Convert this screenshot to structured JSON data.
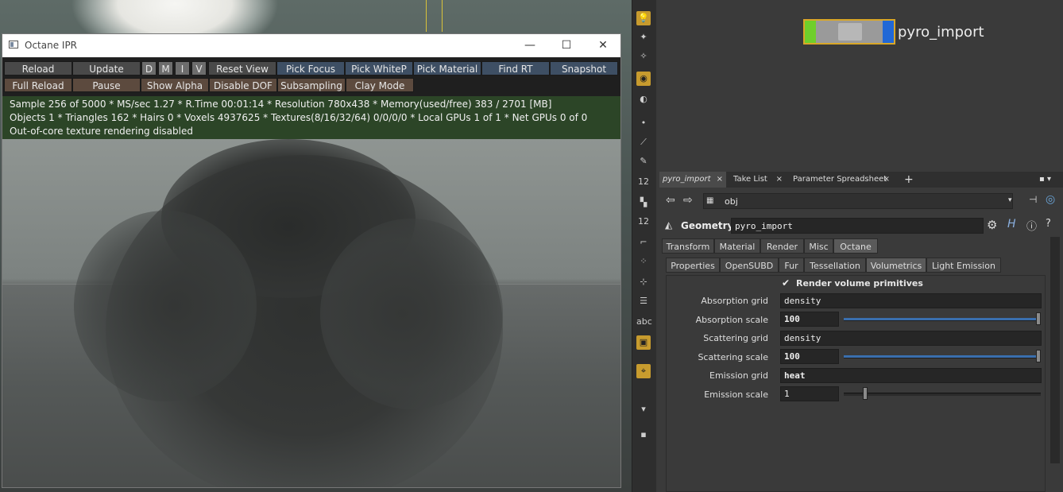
{
  "octane_window": {
    "title": "Octane IPR",
    "window_controls": {
      "minimize": "—",
      "maximize": "☐",
      "close": "✕"
    },
    "toolbar_row1": [
      {
        "id": "reload",
        "label": "Reload"
      },
      {
        "id": "update",
        "label": "Update"
      },
      {
        "id": "d",
        "label": "D"
      },
      {
        "id": "m",
        "label": "M"
      },
      {
        "id": "i",
        "label": "I"
      },
      {
        "id": "v",
        "label": "V"
      },
      {
        "id": "reset-view",
        "label": "Reset View"
      },
      {
        "id": "pick-focus",
        "label": "Pick Focus"
      },
      {
        "id": "pick-whitep",
        "label": "Pick WhiteP"
      },
      {
        "id": "pick-material",
        "label": "Pick Material"
      },
      {
        "id": "find-rt",
        "label": "Find RT"
      },
      {
        "id": "snapshot",
        "label": "Snapshot"
      }
    ],
    "toolbar_row2": [
      {
        "id": "full-reload",
        "label": "Full Reload"
      },
      {
        "id": "pause",
        "label": "Pause"
      },
      {
        "id": "show-alpha",
        "label": "Show Alpha"
      },
      {
        "id": "disable-dof",
        "label": "Disable DOF"
      },
      {
        "id": "subsampling",
        "label": "Subsampling"
      },
      {
        "id": "clay-mode",
        "label": "Clay Mode"
      }
    ],
    "status_lines": [
      "Sample 256 of 5000 * MS/sec 1.27 * R.Time 00:01:14 * Resolution 780x438 * Memory(used/free) 383 / 2701 [MB]",
      "Objects 1 * Triangles 162 * Hairs 0 * Voxels 4937625 * Textures(8/16/32/64) 0/0/0/0 * Local GPUs 1 of 1 * Net GPUs 0 of 0",
      "Out-of-core texture rendering disabled"
    ]
  },
  "network": {
    "node_label": "pyro_import"
  },
  "pane_tabs": [
    {
      "label": "pyro_import",
      "close": "×"
    },
    {
      "label": "Take List",
      "close": "×"
    },
    {
      "label": "Parameter Spreadsheet",
      "close": "×"
    },
    {
      "label": "+"
    }
  ],
  "path": {
    "value": "obj"
  },
  "node_header": {
    "type": "Geometry",
    "name": "pyro_import"
  },
  "main_tabs": [
    "Transform",
    "Material",
    "Render",
    "Misc",
    "Octane"
  ],
  "sub_tabs": [
    "Properties",
    "OpenSUBD",
    "Fur",
    "Tessellation",
    "Volumetrics",
    "Light Emission"
  ],
  "params": {
    "render_volume_label": "Render volume primitives",
    "render_volume_checked": true,
    "absorption_grid": {
      "label": "Absorption grid",
      "value": "density"
    },
    "absorption_scale": {
      "label": "Absorption scale",
      "value": "100",
      "fraction": 1.0
    },
    "scattering_grid": {
      "label": "Scattering grid",
      "value": "density"
    },
    "scattering_scale": {
      "label": "Scattering scale",
      "value": "100",
      "fraction": 1.0
    },
    "emission_grid": {
      "label": "Emission grid",
      "value": "heat"
    },
    "emission_scale": {
      "label": "Emission scale",
      "value": "1",
      "fraction": 0.1
    }
  },
  "shelf_labels": {
    "abc": "abc",
    "twelve": "12"
  },
  "colors": {
    "status_bg": "#2c4527",
    "accent_gold": "#d9a728",
    "slider_blue": "#3a6fae",
    "node_green": "#6fcf2b",
    "node_blue": "#2168d6"
  }
}
